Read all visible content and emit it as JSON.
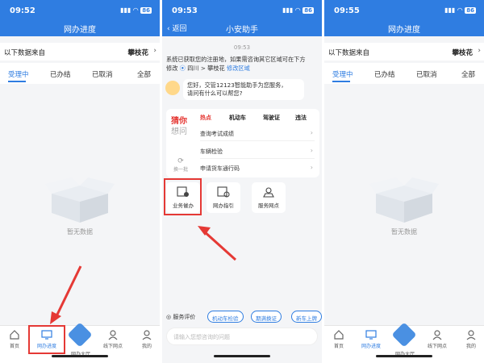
{
  "phones": [
    {
      "time": "09:52",
      "battery": "86",
      "title": "网办进度",
      "source_label": "以下数据来自",
      "source_city": "攀枝花",
      "tabs": [
        "受理中",
        "已办结",
        "已取消",
        "全部"
      ],
      "empty_text": "暂无数据"
    },
    {
      "time": "09:53",
      "battery": "86",
      "back": "返回",
      "title": "小安助手",
      "chat_time": "09:53",
      "sys_msg_1": "系统已获取您的注册地，如果需咨询其它区域可在下方",
      "sys_msg_2": "修改",
      "loc_text": "四川 > 攀枝花",
      "loc_edit": "修改区域",
      "bot_greeting_1": "您好，交管12123智能助手为您服务，",
      "bot_greeting_2": "请问有什么可以帮您?",
      "guess_1": "猜你",
      "guess_2": "想问",
      "refresh": "换一批",
      "card_tabs": [
        "热点",
        "机动车",
        "驾驶证",
        "违法"
      ],
      "questions": [
        "查询考试成绩",
        "车辆检验",
        "申请货车通行码"
      ],
      "services": [
        "业务催办",
        "网办指引",
        "服务网点"
      ],
      "eval_label": "服务评价",
      "quick_pills": [
        "机动车检验",
        "期满换证",
        "新车上牌"
      ],
      "input_placeholder": "请输入您想咨询的问题"
    },
    {
      "time": "09:55",
      "battery": "86",
      "title": "网办进度",
      "source_label": "以下数据来自",
      "source_city": "攀枝花",
      "tabs": [
        "受理中",
        "已办结",
        "已取消",
        "全部"
      ],
      "empty_text": "暂无数据"
    }
  ],
  "bottom_nav": [
    "首页",
    "网办进度",
    "网办大厅",
    "线下网点",
    "我的"
  ],
  "colors": {
    "accent": "#2f7de1",
    "annotation": "#e53935"
  }
}
